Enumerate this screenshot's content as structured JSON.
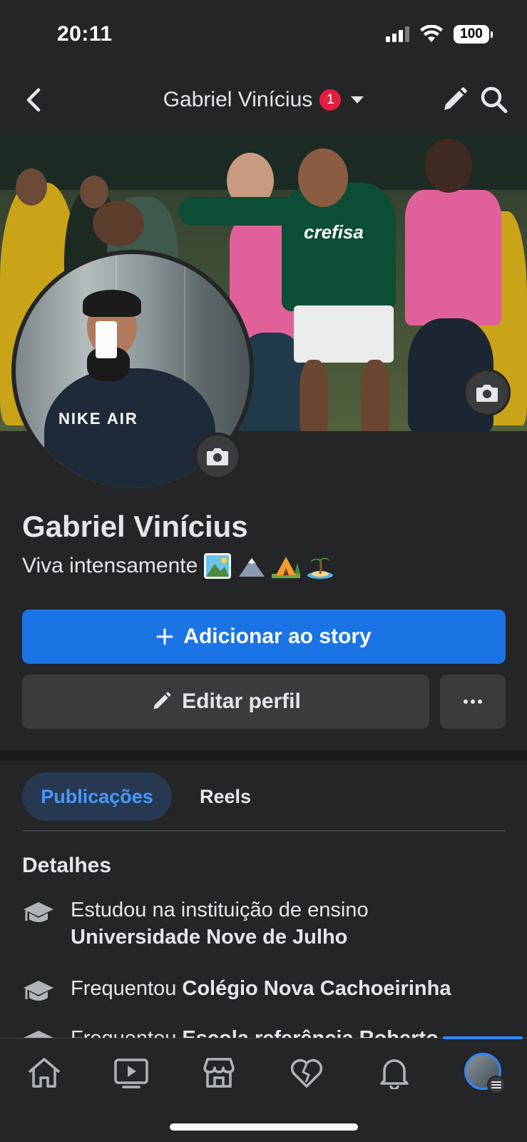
{
  "status_bar": {
    "time": "20:11",
    "battery": "100"
  },
  "header": {
    "title": "Gabriel Vinícius",
    "notification_count": "1"
  },
  "profile": {
    "name": "Gabriel Vinícius",
    "bio": "Viva intensamente",
    "bio_emojis": [
      "picture-emoji",
      "mountain-emoji",
      "camping-emoji",
      "island-emoji"
    ],
    "cover_shirt_text": "crefisa",
    "avatar_shirt_text": "NIKE AIR"
  },
  "actions": {
    "add_story_label": "Adicionar ao story",
    "edit_profile_label": "Editar perfil"
  },
  "tabs": [
    {
      "label": "Publicações",
      "active": true
    },
    {
      "label": "Reels",
      "active": false
    }
  ],
  "details": {
    "title": "Detalhes",
    "items": [
      {
        "prefix": "Estudou na instituição de ensino",
        "strong": "Universidade Nove de Julho"
      },
      {
        "prefix": "Frequentou",
        "strong": "Colégio Nova Cachoeirinha"
      },
      {
        "prefix": "Frequentou",
        "strong": "Escola referência Roberto"
      }
    ]
  },
  "bottom_nav": [
    "home-icon",
    "video-icon",
    "marketplace-icon",
    "dating-heart-icon",
    "notifications-bell-icon",
    "profile-avatar"
  ],
  "colors": {
    "background": "#242526",
    "accent": "#1b74e4",
    "active_tab_text": "#4599ff",
    "badge": "#e41e3f"
  }
}
